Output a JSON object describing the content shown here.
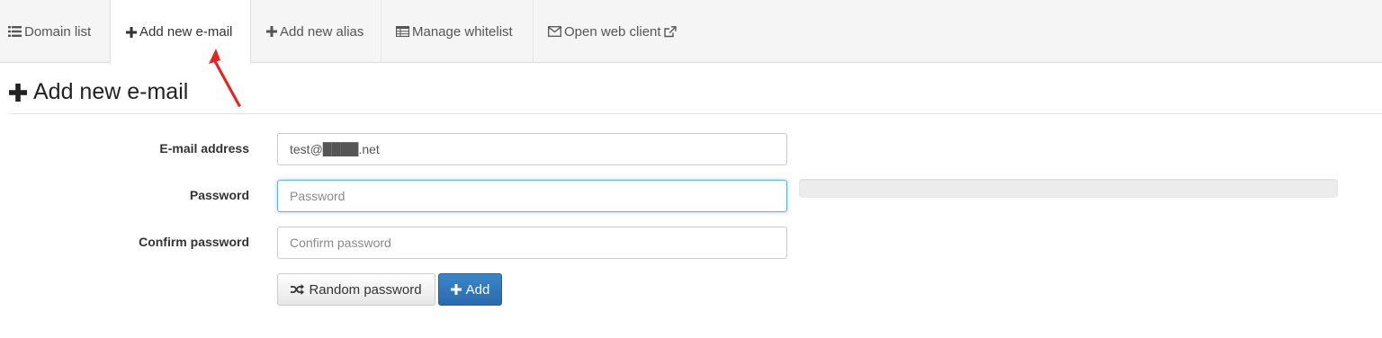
{
  "tabs": [
    {
      "label": "Domain list",
      "icon": "list-icon"
    },
    {
      "label": "Add new e-mail",
      "icon": "plus-icon",
      "active": true
    },
    {
      "label": "Add new alias",
      "icon": "plus-icon"
    },
    {
      "label": "Manage whitelist",
      "icon": "table-icon"
    },
    {
      "label": "Open web client",
      "icon": "envelope-icon",
      "trailing_icon": "external-link-icon"
    }
  ],
  "annotation": {
    "color": "#e8231f"
  },
  "page": {
    "title": "Add new e-mail",
    "title_icon": "plus-icon"
  },
  "form": {
    "email": {
      "label": "E-mail address",
      "value": "test@████.net"
    },
    "password": {
      "label": "Password",
      "value": "",
      "placeholder": "Password"
    },
    "confirm": {
      "label": "Confirm password",
      "value": "",
      "placeholder": "Confirm password"
    },
    "strength_level": 0,
    "random_button": {
      "label": "Random password",
      "icon": "shuffle-icon"
    },
    "add_button": {
      "label": "Add",
      "icon": "plus-icon"
    }
  },
  "colors": {
    "primary": "#2f74b8",
    "focus": "#66afe9"
  }
}
